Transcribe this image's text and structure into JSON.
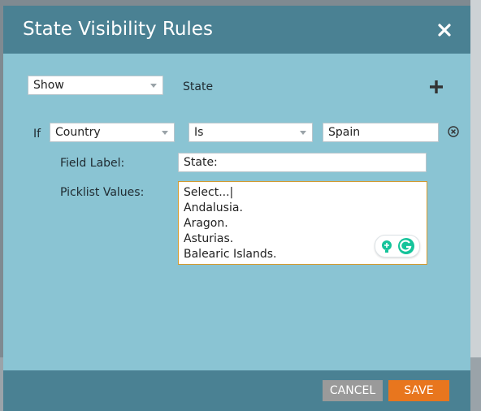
{
  "dialog": {
    "title": "State Visibility Rules",
    "close_icon": "close-icon"
  },
  "rule": {
    "action_value": "Show",
    "target_label": "State",
    "add_icon": "plus-icon"
  },
  "condition": {
    "if_label": "If",
    "field_value": "Country",
    "operator_value": "Is",
    "value": "Spain",
    "remove_icon": "remove-circle-icon"
  },
  "field_label": {
    "label": "Field Label:",
    "value": "State:"
  },
  "picklist": {
    "label": "Picklist Values:",
    "lines": [
      "Select...|",
      "Andalusia.",
      "Aragon.",
      "Asturias.",
      "Balearic Islands."
    ]
  },
  "footer": {
    "cancel_label": "CANCEL",
    "save_label": "SAVE"
  },
  "colors": {
    "header": "#4a8193",
    "body": "#8ac4d3",
    "save": "#e8761e",
    "cancel": "#9a9a9a",
    "focus_border": "#d39a2f"
  }
}
